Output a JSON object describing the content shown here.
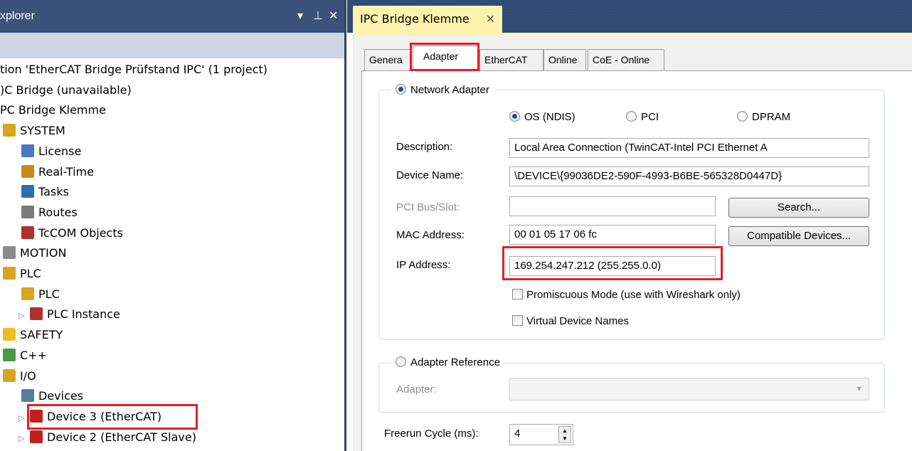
{
  "explorer": {
    "title": "xplorer",
    "controls": [
      "▾",
      "⊥",
      "✕"
    ],
    "tree": [
      {
        "label": "tion 'EtherCAT Bridge Prüfstand IPC' (1 project)",
        "icon": "",
        "indent": 0
      },
      {
        "label": ")C Bridge (unavailable)",
        "icon": "",
        "indent": 0
      },
      {
        "label": "PC Bridge Klemme",
        "icon": "",
        "indent": 0
      },
      {
        "label": "SYSTEM",
        "icon": "system-icon",
        "indent": 1
      },
      {
        "label": "License",
        "icon": "license-icon",
        "indent": 2
      },
      {
        "label": "Real-Time",
        "icon": "realtime-icon",
        "indent": 2
      },
      {
        "label": "Tasks",
        "icon": "tasks-icon",
        "indent": 2
      },
      {
        "label": "Routes",
        "icon": "routes-icon",
        "indent": 2
      },
      {
        "label": "TcCOM Objects",
        "icon": "tccom-icon",
        "indent": 2
      },
      {
        "label": "MOTION",
        "icon": "motion-icon",
        "indent": 1
      },
      {
        "label": "PLC",
        "icon": "plc-folder-icon",
        "indent": 1
      },
      {
        "label": "PLC",
        "icon": "plc-project-icon",
        "indent": 2
      },
      {
        "label": "PLC Instance",
        "icon": "plc-instance-icon",
        "indent": 3
      },
      {
        "label": "SAFETY",
        "icon": "safety-icon",
        "indent": 1
      },
      {
        "label": "C++",
        "icon": "cpp-icon",
        "indent": 1
      },
      {
        "label": "I/O",
        "icon": "io-icon",
        "indent": 1
      },
      {
        "label": "Devices",
        "icon": "devices-icon",
        "indent": 2
      },
      {
        "label": "Device 3 (EtherCAT)",
        "icon": "ethercat-device-icon",
        "indent": 3
      },
      {
        "label": "Device 2 (EtherCAT Slave)",
        "icon": "ethercat-slave-icon",
        "indent": 3
      }
    ]
  },
  "document": {
    "tab_title": "IPC Bridge Klemme",
    "tab_close": "✕",
    "tabs": [
      "Genera",
      "Adapter",
      "EtherCAT",
      "Online",
      "CoE - Online"
    ],
    "active_tab": "Adapter",
    "network_adapter": {
      "label": "Network Adapter",
      "options": [
        "OS (NDIS)",
        "PCI",
        "DPRAM"
      ],
      "selected": "OS (NDIS)",
      "description_label": "Description:",
      "description_value": "Local Area Connection (TwinCAT-Intel PCI Ethernet A",
      "device_name_label": "Device Name:",
      "device_name_value": "\\DEVICE\\{99036DE2-590F-4993-B6BE-565328D0447D}",
      "pci_label": "PCI Bus/Slot:",
      "pci_value": "",
      "search_button": "Search...",
      "mac_label": "MAC Address:",
      "mac_value": "00 01 05 17 06 fc",
      "compatible_button": "Compatible Devices...",
      "ip_label": "IP Address:",
      "ip_value": "169.254.247.212 (255.255.0.0)",
      "promiscuous_label": "Promiscuous Mode (use with Wireshark only)",
      "virtual_names_label": "Virtual Device Names"
    },
    "adapter_reference": {
      "label": "Adapter Reference",
      "adapter_label": "Adapter:",
      "adapter_value": ""
    },
    "freerun_label": "Freerun Cycle (ms):",
    "freerun_value": "4"
  },
  "colors": {
    "title_bar": "#3b5378",
    "doc_tab": "#fff3b0",
    "highlight": "#e0202a"
  }
}
